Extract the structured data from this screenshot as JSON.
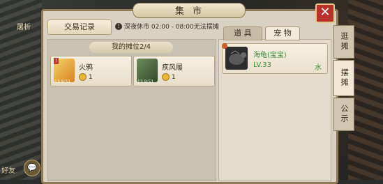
{
  "window": {
    "title": "集市",
    "close_symbol": "✕"
  },
  "hud": {
    "left_label": "屠析",
    "chat_label": "好友",
    "chat_btn": "💬"
  },
  "header": {
    "records_button": "交易记录",
    "notice_icon": "!",
    "notice_text": "深夜休市 02:00 - 08:00无法摆摊"
  },
  "stalls": {
    "heading": "我的摊位2/4"
  },
  "items": [
    {
      "name": "火鸦",
      "price": "1",
      "cd": "13.9:51",
      "badge": "!",
      "icon": "fire-crow-icon",
      "color": "#d89a1e"
    },
    {
      "name": "疾风履",
      "price": "1",
      "cd": "13.9:51",
      "icon": "boots-icon",
      "color": "#3e6a3a"
    }
  ],
  "tabs": [
    {
      "label": "道 具",
      "active": false
    },
    {
      "label": "宠 物",
      "active": true
    }
  ],
  "pet": {
    "name": "海龟(宝宝)",
    "level": "LV.33",
    "element": "水",
    "icon": "turtle-icon"
  },
  "side_tabs": [
    {
      "label": "逛摊",
      "active": false
    },
    {
      "label": "摆摊",
      "active": true
    },
    {
      "label": "公示",
      "active": false
    }
  ]
}
